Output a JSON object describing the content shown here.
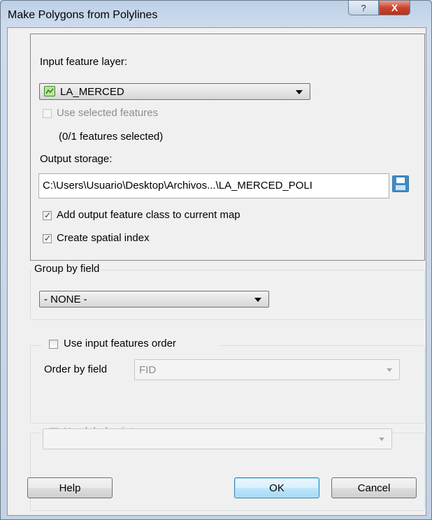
{
  "window": {
    "title": "Make Polygons from Polylines",
    "help_glyph": "?",
    "close_glyph": "X"
  },
  "input_group": {
    "input_label": "Input feature layer:",
    "layer_value": "LA_MERCED",
    "layer_icon": "polyline-layer-icon",
    "use_selected_label": "Use selected features",
    "use_selected_checked": false,
    "use_selected_enabled": false,
    "selection_count": "(0/1 features selected)",
    "output_label": "Output storage:",
    "output_path": "C:\\Users\\Usuario\\Desktop\\Archivos...\\LA_MERCED_POLI",
    "save_icon": "floppy-disk-icon",
    "add_output_label": "Add output feature class to current map",
    "add_output_checked": true,
    "spatial_index_label": "Create spatial index",
    "spatial_index_checked": true
  },
  "group_by": {
    "legend": "Group by field",
    "value": "- NONE -"
  },
  "order_group": {
    "legend": "Use input features order",
    "checked": false,
    "order_label": "Order by field",
    "order_value": "FID"
  },
  "label_points": {
    "legend": "Use label points",
    "checked": false,
    "enabled": false,
    "value": ""
  },
  "buttons": {
    "help": "Help",
    "ok": "OK",
    "cancel": "Cancel"
  },
  "colors": {
    "accent": "#3c7fb1",
    "close": "#c9452e"
  }
}
